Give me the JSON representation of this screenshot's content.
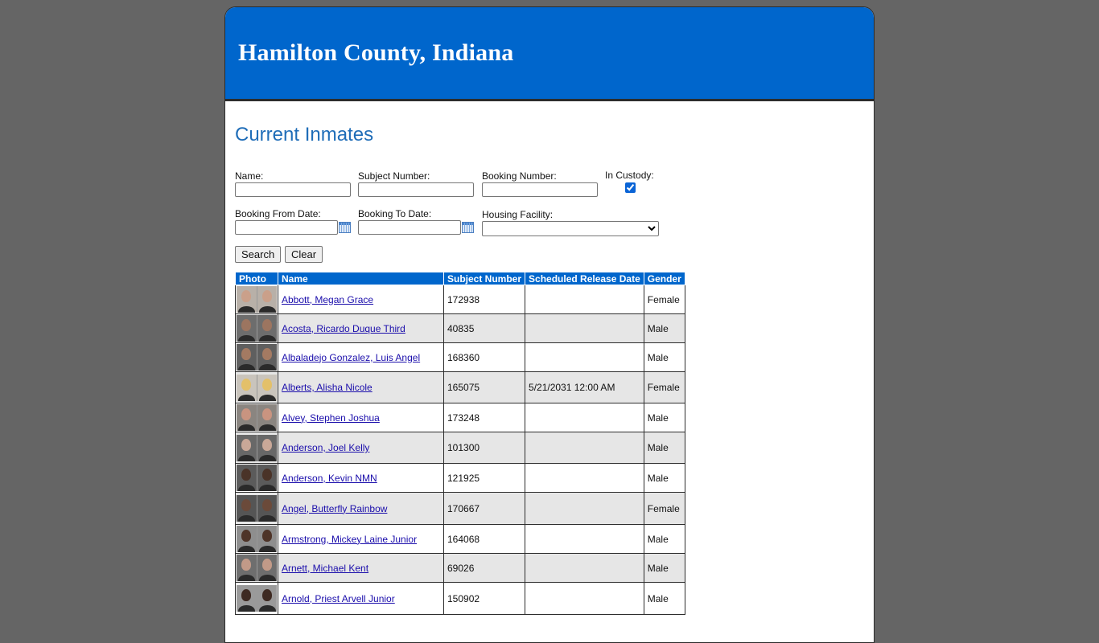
{
  "header": {
    "title": "Hamilton County, Indiana"
  },
  "page_title": "Current Inmates",
  "search": {
    "name_label": "Name:",
    "subject_number_label": "Subject Number:",
    "booking_number_label": "Booking Number:",
    "in_custody_label": "In Custody:",
    "in_custody_checked": true,
    "booking_from_label": "Booking From Date:",
    "booking_to_label": "Booking To Date:",
    "housing_facility_label": "Housing Facility:",
    "housing_facility_selected": "",
    "search_label": "Search",
    "clear_label": "Clear"
  },
  "table": {
    "columns": [
      "Photo",
      "Name",
      "Subject Number",
      "Scheduled Release Date",
      "Gender"
    ],
    "rows": [
      {
        "name": "Abbott, Megan Grace",
        "subject_number": "172938",
        "release": "",
        "gender": "Female",
        "skin": "#caa08a",
        "bg": "#b8b0a8"
      },
      {
        "name": "Acosta, Ricardo Duque Third",
        "subject_number": "40835",
        "release": "",
        "gender": "Male",
        "skin": "#9c7560",
        "bg": "#6d6d6d"
      },
      {
        "name": "Albaladejo Gonzalez, Luis Angel",
        "subject_number": "168360",
        "release": "",
        "gender": "Male",
        "skin": "#a47a62",
        "bg": "#5f5f5f"
      },
      {
        "name": "Alberts, Alisha Nicole",
        "subject_number": "165075",
        "release": "5/21/2031 12:00 AM",
        "gender": "Female",
        "skin": "#e3c06a",
        "bg": "#c9c4bc"
      },
      {
        "name": "Alvey, Stephen Joshua",
        "subject_number": "173248",
        "release": "",
        "gender": "Male",
        "skin": "#c99480",
        "bg": "#8a8580"
      },
      {
        "name": "Anderson, Joel Kelly",
        "subject_number": "101300",
        "release": "",
        "gender": "Male",
        "skin": "#c9a898",
        "bg": "#686868"
      },
      {
        "name": "Anderson, Kevin NMN",
        "subject_number": "121925",
        "release": "",
        "gender": "Male",
        "skin": "#4a3328",
        "bg": "#5b5b5b"
      },
      {
        "name": "Angel, Butterfly Rainbow",
        "subject_number": "170667",
        "release": "",
        "gender": "Female",
        "skin": "#6b4a3a",
        "bg": "#555555"
      },
      {
        "name": "Armstrong, Mickey Laine Junior",
        "subject_number": "164068",
        "release": "",
        "gender": "Male",
        "skin": "#4e3428",
        "bg": "#8e8e8e"
      },
      {
        "name": "Arnett, Michael Kent",
        "subject_number": "69026",
        "release": "",
        "gender": "Male",
        "skin": "#c29a88",
        "bg": "#6e6e6e"
      },
      {
        "name": "Arnold, Priest Arvell Junior",
        "subject_number": "150902",
        "release": "",
        "gender": "Male",
        "skin": "#3e2a22",
        "bg": "#9a9a9a"
      }
    ]
  }
}
